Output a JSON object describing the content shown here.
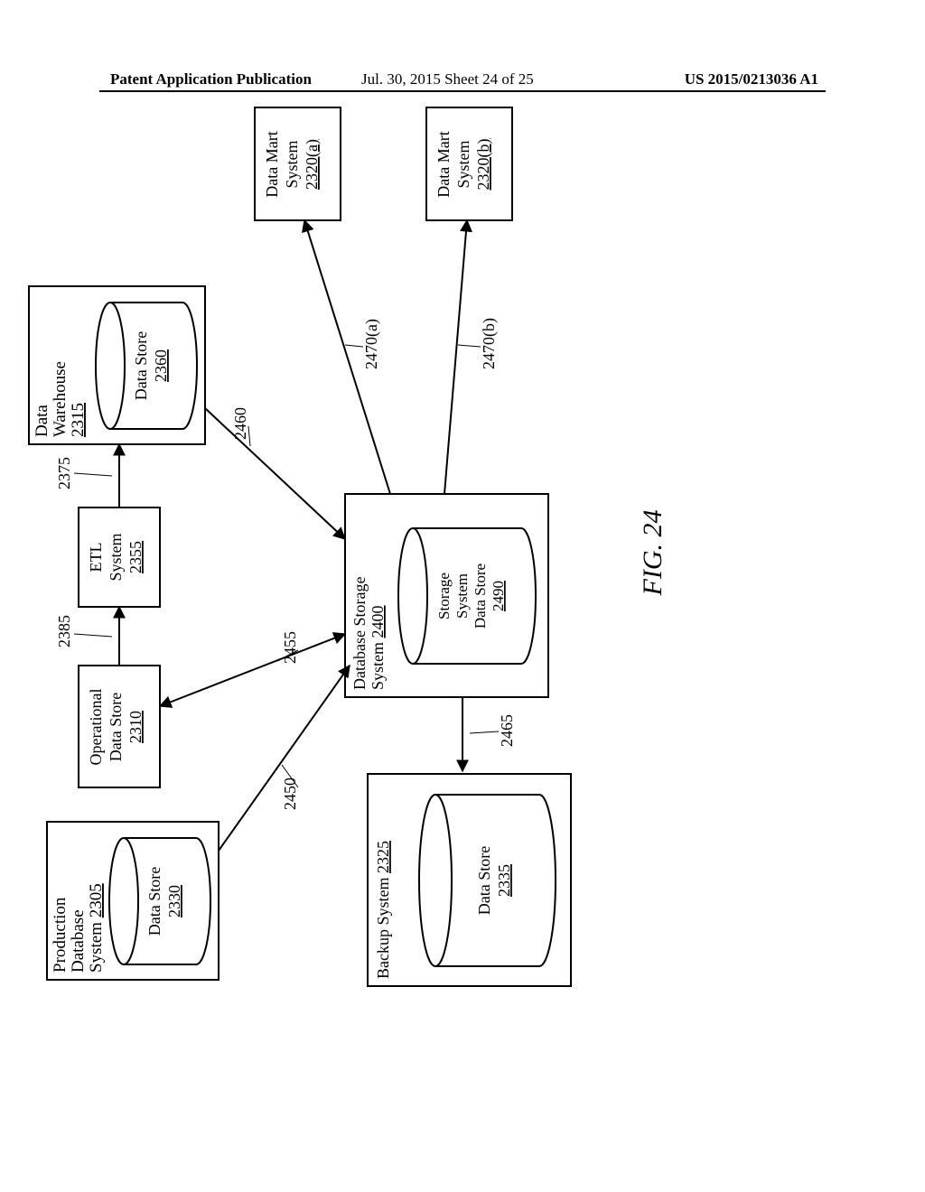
{
  "header": {
    "left": "Patent Application Publication",
    "mid": "Jul. 30, 2015  Sheet 24 of 25",
    "right": "US 2015/0213036 A1"
  },
  "figure_label": "FIG. 24",
  "boxes": {
    "prod_db": {
      "title1": "Production",
      "title2": "Database",
      "title3_text": "System ",
      "title3_num": "2305"
    },
    "prod_ds": {
      "l1": "Data Store",
      "l2": "2330"
    },
    "ods": {
      "l1": "Operational",
      "l2": "Data Store",
      "l3": "2310"
    },
    "etl": {
      "l1": "ETL",
      "l2": "System",
      "l3": "2355"
    },
    "dw": {
      "l1": "Data",
      "l2": "Warehouse",
      "l3": "2315"
    },
    "dw_ds": {
      "l1": "Data Store",
      "l2": "2360"
    },
    "dss": {
      "l1": "Database Storage",
      "l2_text": "System ",
      "l2_num": "2400"
    },
    "dss_ds": {
      "l1": "Storage",
      "l2": "System",
      "l3": "Data Store",
      "l4": "2490"
    },
    "backup": {
      "l1_text": "Backup System ",
      "l1_num": "2325"
    },
    "backup_ds": {
      "l1": "Data Store",
      "l2": "2335"
    },
    "dm_a": {
      "l1": "Data Mart",
      "l2": "System",
      "l3": "2320(a)"
    },
    "dm_b": {
      "l1": "Data Mart",
      "l2": "System",
      "l3": "2320(b)"
    }
  },
  "arrows": {
    "a2450": "2450",
    "a2455": "2455",
    "a2460": "2460",
    "a2465": "2465",
    "a2470a": "2470(a)",
    "a2470b": "2470(b)",
    "a2385": "2385",
    "a2375": "2375"
  }
}
